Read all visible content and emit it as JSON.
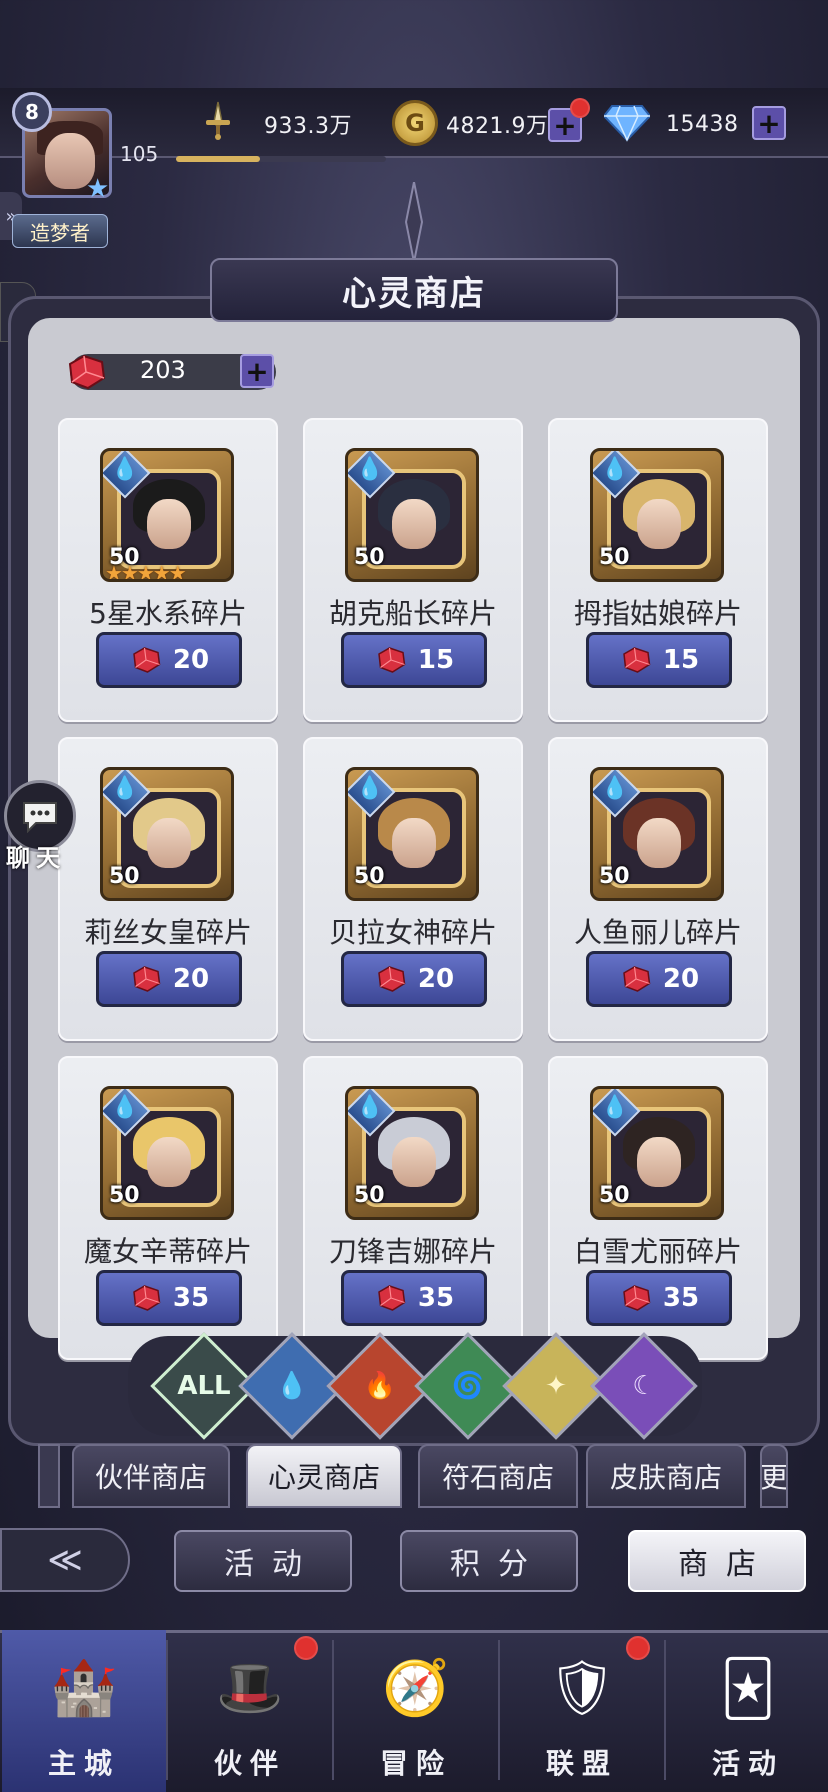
{
  "player": {
    "vip_level": "8",
    "level": "105",
    "xp_fraction": 0.4,
    "title": "造梦者"
  },
  "resources": {
    "power": "933.3万",
    "gold": "4821.9万",
    "diamonds": "15438"
  },
  "shop": {
    "title": "心灵商店",
    "currency_amount": "203",
    "items": [
      {
        "name": "5星水系碎片",
        "qty": "50",
        "price": "20",
        "stars": "★★★★★",
        "hair": "#1b1b1b"
      },
      {
        "name": "胡克船长碎片",
        "qty": "50",
        "price": "15",
        "stars": "",
        "hair": "#2a2f40"
      },
      {
        "name": "拇指姑娘碎片",
        "qty": "50",
        "price": "15",
        "stars": "",
        "hair": "#d8b56c"
      },
      {
        "name": "莉丝女皇碎片",
        "qty": "50",
        "price": "20",
        "stars": "",
        "hair": "#e2c98a"
      },
      {
        "name": "贝拉女神碎片",
        "qty": "50",
        "price": "20",
        "stars": "",
        "hair": "#b9894a"
      },
      {
        "name": "人鱼丽儿碎片",
        "qty": "50",
        "price": "20",
        "stars": "",
        "hair": "#6b3326"
      },
      {
        "name": "魔女辛蒂碎片",
        "qty": "50",
        "price": "35",
        "stars": "",
        "hair": "#e9c66a"
      },
      {
        "name": "刀锋吉娜碎片",
        "qty": "50",
        "price": "35",
        "stars": "",
        "hair": "#c9ccd6"
      },
      {
        "name": "白雪尤丽碎片",
        "qty": "50",
        "price": "35",
        "stars": "",
        "hair": "#2e2422"
      }
    ]
  },
  "filters": [
    {
      "name": "all",
      "label": "ALL",
      "color": "#3a4b4a",
      "text_color": "#e6fbe8"
    },
    {
      "name": "water",
      "label": "💧",
      "color": "#3f6db0",
      "text_color": "#cfe6ff"
    },
    {
      "name": "fire",
      "label": "🔥",
      "color": "#b8452e",
      "text_color": "#ffe0c8"
    },
    {
      "name": "wind",
      "label": "🌀",
      "color": "#3f8a55",
      "text_color": "#dcffe6"
    },
    {
      "name": "light",
      "label": "✦",
      "color": "#c8b45a",
      "text_color": "#fff6c8"
    },
    {
      "name": "dark",
      "label": "☾",
      "color": "#7a4eb8",
      "text_color": "#efe0ff"
    }
  ],
  "tabs": [
    "伙伴商店",
    "心灵商店",
    "符石商店",
    "皮肤商店",
    "更"
  ],
  "subnav": [
    "活动",
    "积分",
    "商店"
  ],
  "bottom_nav": [
    {
      "label": "主城",
      "icon": "🏰"
    },
    {
      "label": "伙伴",
      "icon": "🎩"
    },
    {
      "label": "冒险",
      "icon": "🧭"
    },
    {
      "label": "联盟",
      "icon": "🛡"
    },
    {
      "label": "活动",
      "icon": "🃏"
    }
  ],
  "chat_label": "聊天"
}
